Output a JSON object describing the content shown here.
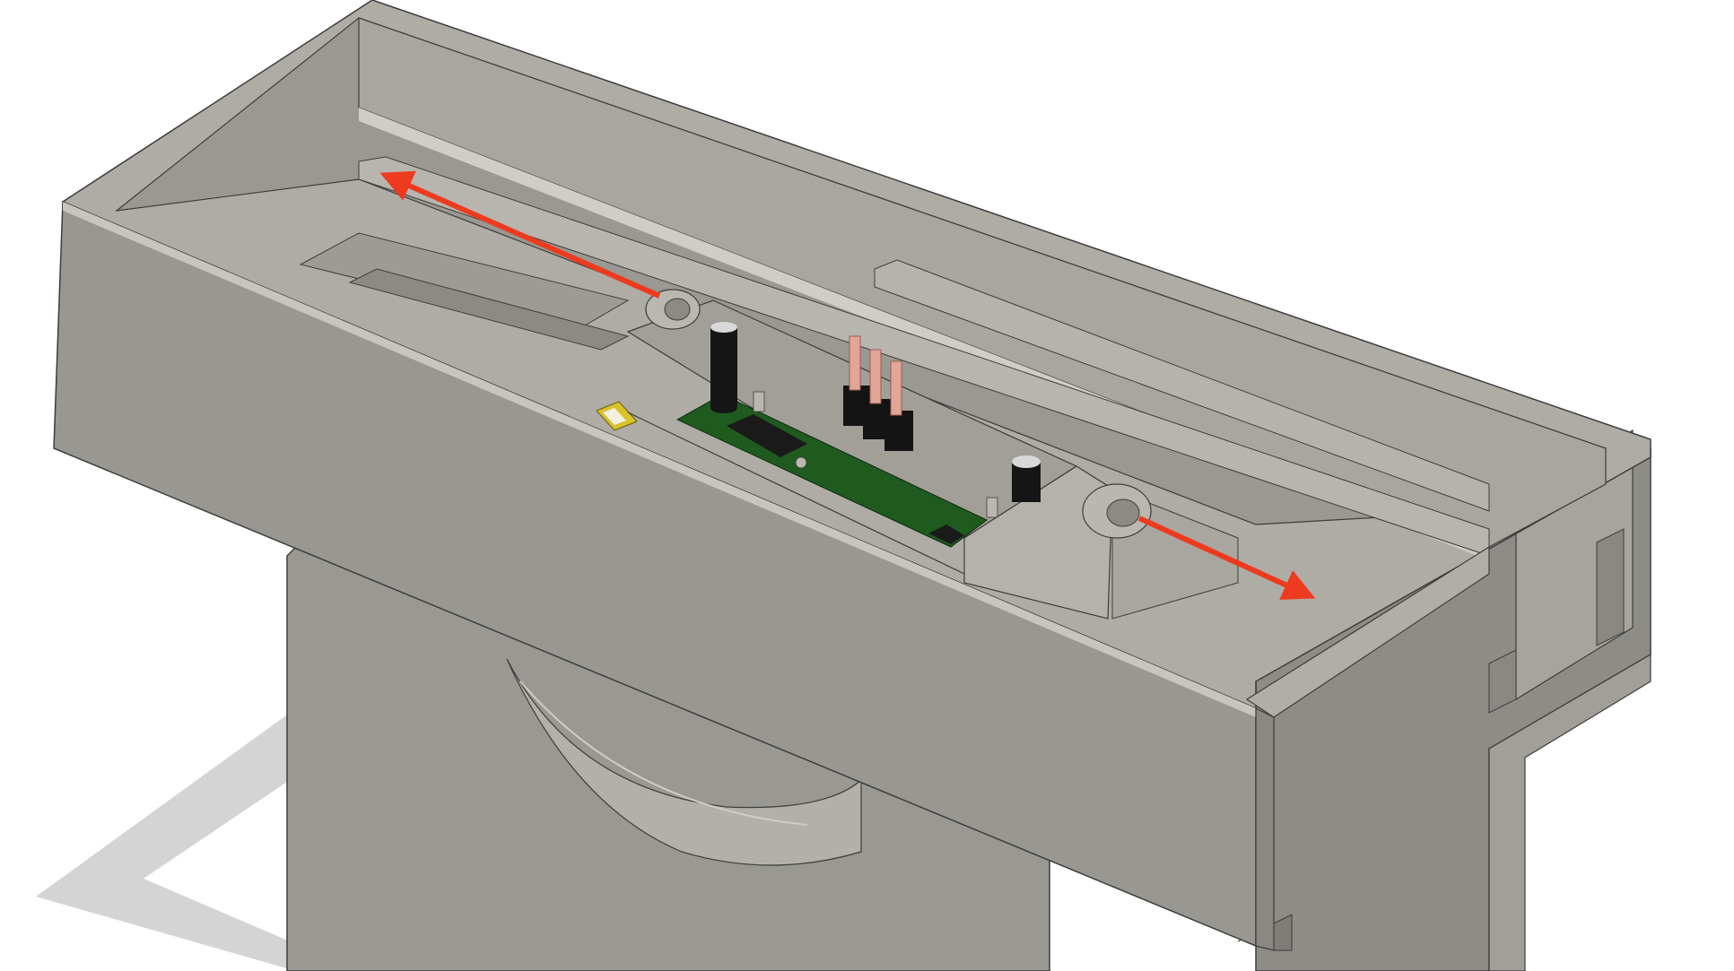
{
  "colors": {
    "background": "#ffffff",
    "shadow": "#d4d4d4",
    "body_light": "#aeaca5",
    "body_mid": "#a3a19a",
    "body_front": "#999791",
    "body_dark": "#8d8b85",
    "edge": "#3d3d3b",
    "edge_light": "#cfcdc6",
    "pcb": "#1f5b1f",
    "capacitor": "#151515",
    "capacitor_top": "#d8d8d8",
    "header_pin": "#e3a598",
    "header_block": "#141414",
    "ic": "#1a1a1a",
    "connector": "#d9c22a",
    "arrow": "#ee3a1e"
  },
  "icons": [
    "arrow-left-icon",
    "arrow-right-icon"
  ]
}
